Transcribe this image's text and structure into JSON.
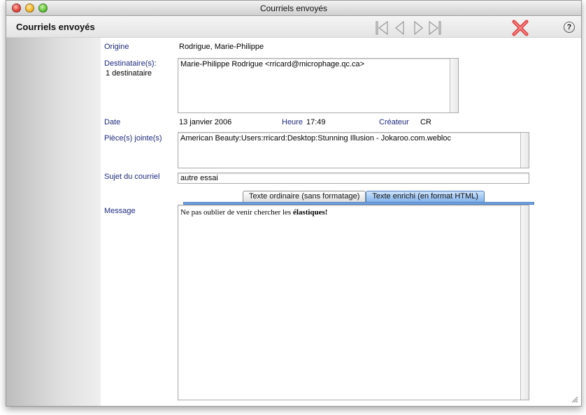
{
  "window": {
    "title": "Courriels envoyés"
  },
  "header": {
    "app_title": "Courriels envoyés",
    "help_label": "?"
  },
  "toolbar": {
    "nav_icons": [
      "first-record-icon",
      "previous-record-icon",
      "next-record-icon",
      "last-record-icon"
    ],
    "delete_icon": "delete-x-icon",
    "delete_color": "#e24040"
  },
  "form": {
    "origine_label": "Origine",
    "origine_value": "Rodrigue, Marie-Philippe",
    "destinataires_label": "Destinataire(s):",
    "destinataires_count": "1 destinataire",
    "destinataires_value": "Marie-Philippe Rodrigue <rricard@microphage.qc.ca>",
    "date_label": "Date",
    "date_value": "13 janvier 2006",
    "heure_label": "Heure",
    "heure_value": "17:49",
    "createur_label": "Créateur",
    "createur_value": "CR",
    "pieces_label": "Pièce(s) jointe(s)",
    "pieces_value": "American Beauty:Users:rricard:Desktop:Stunning Illusion - Jokaroo.com.webloc",
    "sujet_label": "Sujet du courriel",
    "sujet_value": "autre essai",
    "message_label": "Message"
  },
  "tabs": [
    {
      "label": "Texte ordinaire (sans formatage)",
      "active": false
    },
    {
      "label": "Texte enrichi (en format HTML)",
      "active": true
    }
  ],
  "message": {
    "text_before": "Ne pas oublier de venir chercher les ",
    "text_bold": "élastiques!"
  },
  "colors": {
    "label_blue": "#1d2a8c",
    "tab_active": "#7fb1ec"
  }
}
